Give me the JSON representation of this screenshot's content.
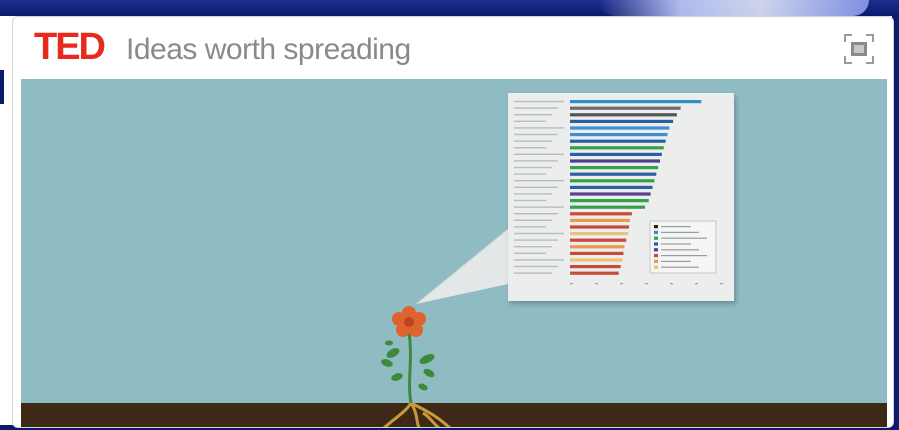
{
  "header": {
    "logo_text": "TED",
    "tagline": "Ideas worth spreading"
  },
  "icons": {
    "fullscreen": "fullscreen-icon",
    "flower": "flower-icon"
  },
  "colors": {
    "brand_red": "#e62b1e",
    "sky": "#8fbcc3",
    "ground": "#3e2816",
    "flower": "#e0632d",
    "leaf": "#3e8a3c"
  },
  "chart_data": {
    "type": "bar",
    "orientation": "horizontal",
    "categories": [
      "",
      "",
      "",
      "",
      "",
      "",
      "",
      "",
      "",
      "",
      "",
      "",
      "",
      "",
      "",
      "",
      "",
      "",
      "",
      "",
      "",
      "",
      "",
      "",
      "",
      "",
      ""
    ],
    "series": [
      {
        "values": [
          140,
          118,
          114,
          110,
          106,
          104,
          102,
          100,
          98,
          96,
          94,
          92,
          90,
          88,
          86,
          84,
          80,
          66,
          64,
          63,
          62,
          60,
          58,
          57,
          56,
          54,
          52
        ],
        "colors": [
          "#2f8fc8",
          "#6c6c6c",
          "#555555",
          "#2c5f9e",
          "#3e8fcf",
          "#3e8fcf",
          "#2c5f9e",
          "#33a04b",
          "#2c5f9e",
          "#4b3e8f",
          "#33a04b",
          "#2c5f9e",
          "#33a04b",
          "#2c5f9e",
          "#5b3e8f",
          "#33a04b",
          "#33a04b",
          "#c84a3a",
          "#e89a4a",
          "#c84a3a",
          "#e8c27a",
          "#c84a3a",
          "#e89a4a",
          "#c84a3a",
          "#e8c27a",
          "#c84a3a",
          "#c84a3a"
        ]
      }
    ],
    "legend_colors": [
      "#222222",
      "#2f8fc8",
      "#33a04b",
      "#2c5f9e",
      "#4b3e8f",
      "#c84a3a",
      "#e89a4a",
      "#e8c27a"
    ],
    "legend_placement": "bottom-right",
    "xlim": [
      0,
      160
    ],
    "grid": false
  }
}
